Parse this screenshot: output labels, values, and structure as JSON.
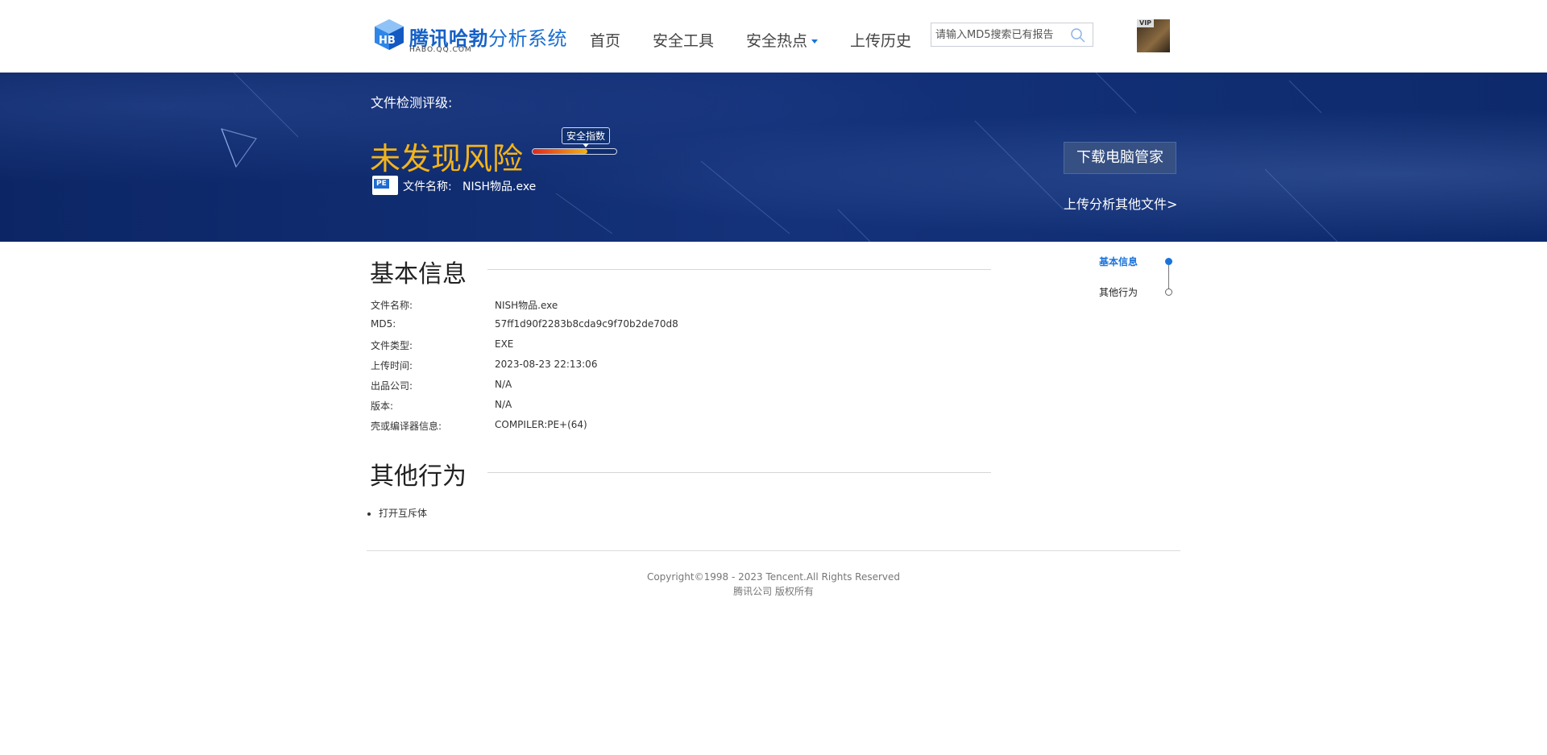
{
  "header": {
    "logo_main": "腾讯哈勃",
    "logo_rest": "分析系统",
    "logo_sub": "HABO.QQ.COM",
    "nav": [
      "首页",
      "安全工具",
      "安全热点",
      "上传历史"
    ],
    "search_placeholder": "请输入MD5搜索已有报告",
    "search_icon": "search-icon",
    "avatar_badge": "VIP"
  },
  "banner": {
    "rating_label": "文件检测评级:",
    "risk_text": "未发现风险",
    "meter_label": "安全指数",
    "meter_level": 0.65,
    "file_icon": "PE",
    "file_label": "文件名称:",
    "file_name": "NISH物品.exe",
    "download_button": "下载电脑管家",
    "upload_link": "上传分析其他文件>"
  },
  "basic_info": {
    "title": "基本信息",
    "rows": [
      {
        "key": "文件名称:",
        "value": "NISH物品.exe"
      },
      {
        "key": "MD5:",
        "value": "57ff1d90f2283b8cda9c9f70b2de70d8"
      },
      {
        "key": "文件类型:",
        "value": "EXE"
      },
      {
        "key": "上传时间:",
        "value": "2023-08-23 22:13:06"
      },
      {
        "key": "出品公司:",
        "value": "N/A"
      },
      {
        "key": "版本:",
        "value": "N/A"
      },
      {
        "key": "壳或编译器信息:",
        "value": "COMPILER:PE+(64)"
      }
    ]
  },
  "other_behavior": {
    "title": "其他行为",
    "items": [
      "打开互斥体"
    ]
  },
  "side_nav": {
    "items": [
      "基本信息",
      "其他行为"
    ],
    "active": 0
  },
  "footer": {
    "copyright": "Copyright©1998 - 2023 Tencent.All Rights Reserved",
    "owner": "腾讯公司 版权所有"
  },
  "colors": {
    "accent": "#1a73d9",
    "risk": "#f4b41a",
    "banner": "#14327a"
  }
}
